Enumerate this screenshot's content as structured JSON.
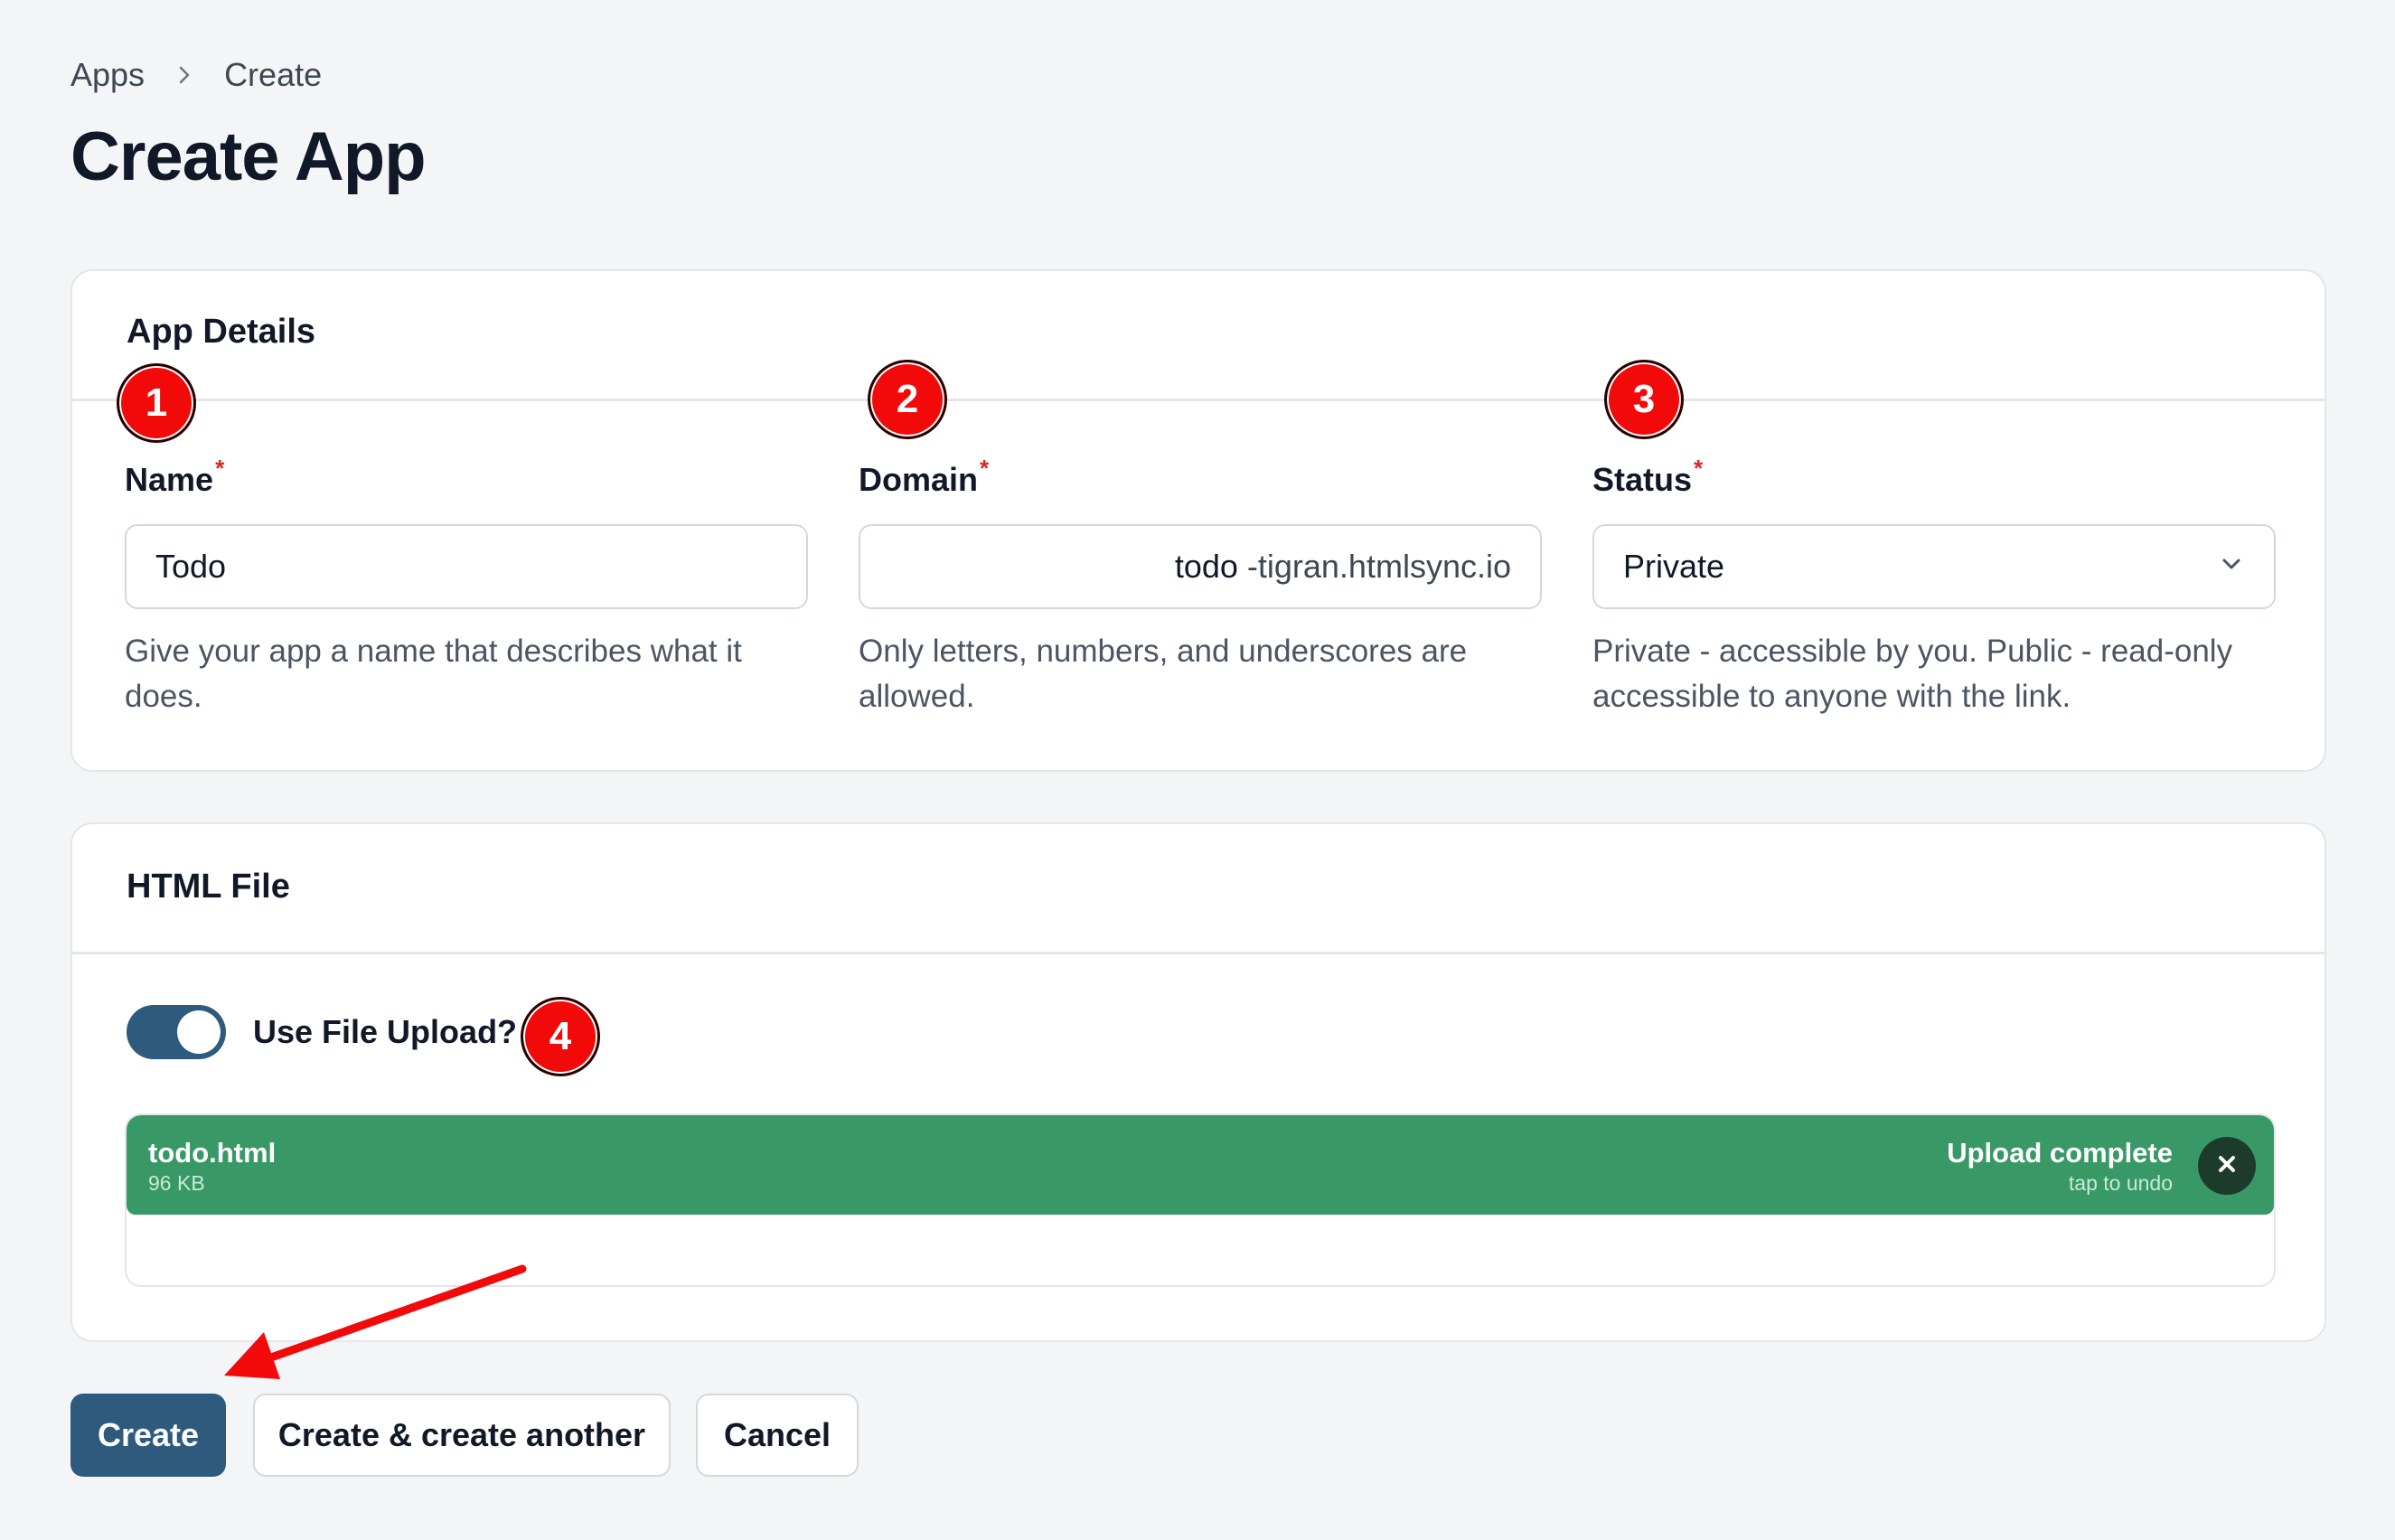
{
  "breadcrumb": {
    "parent": "Apps",
    "current": "Create"
  },
  "page": {
    "title": "Create App"
  },
  "details": {
    "title": "App Details",
    "required_mark": "*",
    "name": {
      "label": "Name",
      "value": "Todo",
      "helper": "Give your app a name that describes what it does."
    },
    "domain": {
      "label": "Domain",
      "value": "todo",
      "suffix": "-tigran.htmlsync.io",
      "helper": "Only letters, numbers, and underscores are allowed."
    },
    "status": {
      "label": "Status",
      "value": "Private",
      "helper": "Private - accessible by you. Public - read-only accessible to anyone with the link."
    }
  },
  "html_file": {
    "title": "HTML File",
    "toggle_label": "Use File Upload?",
    "toggle_on": true,
    "file": {
      "name": "todo.html",
      "size": "96 KB",
      "status": "Upload complete",
      "sub": "tap to undo"
    }
  },
  "actions": {
    "create": "Create",
    "create_another": "Create & create another",
    "cancel": "Cancel"
  },
  "annotations": {
    "m1": "1",
    "m2": "2",
    "m3": "3",
    "m4": "4"
  },
  "colors": {
    "primary": "#2e5a7e",
    "success": "#389967",
    "marker": "#f20a0a",
    "required": "#e02424"
  }
}
